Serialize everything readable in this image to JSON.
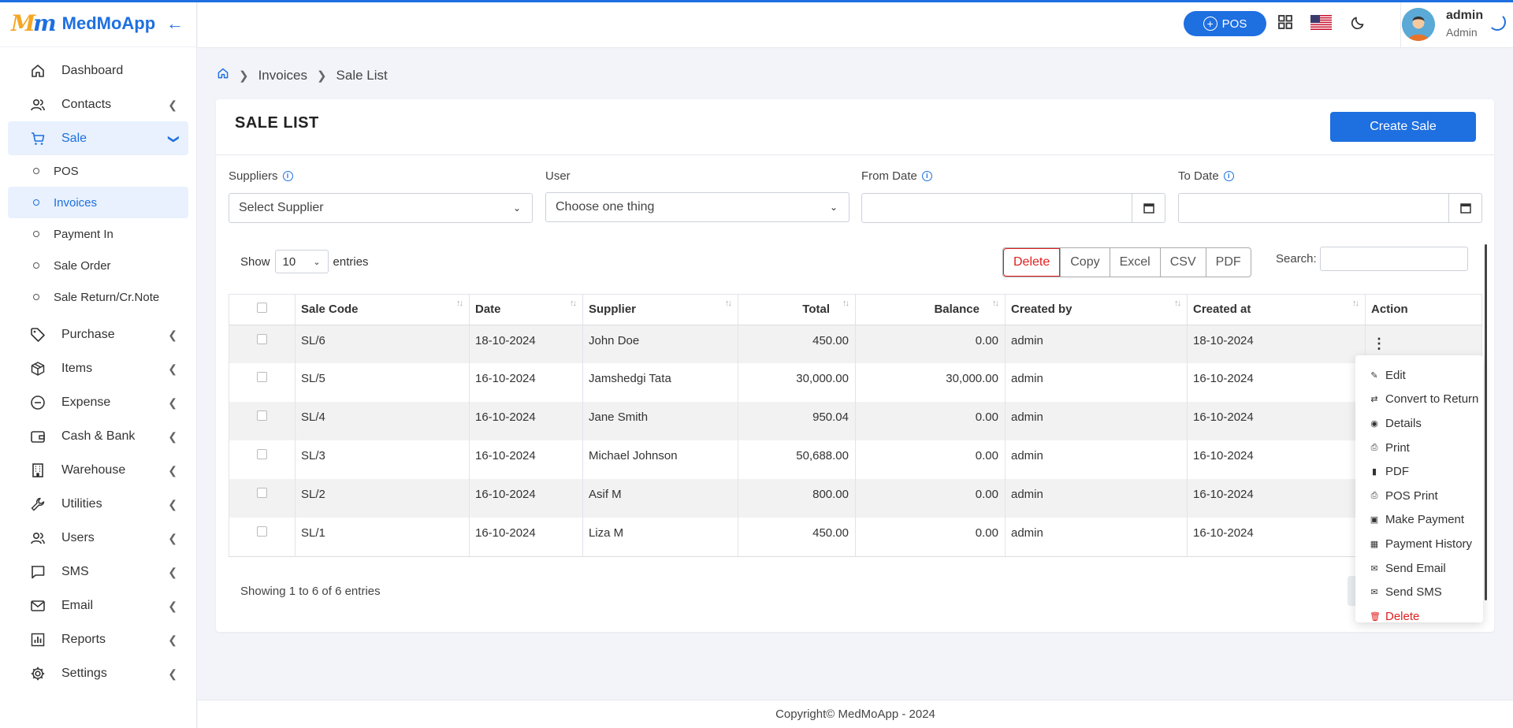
{
  "brand": {
    "logo": "Mm",
    "name": "MedMoApp"
  },
  "sidebar": {
    "items": [
      {
        "label": "Dashboard",
        "icon": "home-icon"
      },
      {
        "label": "Contacts",
        "icon": "users-icon"
      },
      {
        "label": "Sale",
        "icon": "cart-icon"
      },
      {
        "label": "Purchase",
        "icon": "tag-icon"
      },
      {
        "label": "Items",
        "icon": "box-icon"
      },
      {
        "label": "Expense",
        "icon": "minus-circle-icon"
      },
      {
        "label": "Cash & Bank",
        "icon": "wallet-icon"
      },
      {
        "label": "Warehouse",
        "icon": "building-icon"
      },
      {
        "label": "Utilities",
        "icon": "wrench-icon"
      },
      {
        "label": "Users",
        "icon": "users-icon"
      },
      {
        "label": "SMS",
        "icon": "message-icon"
      },
      {
        "label": "Email",
        "icon": "mail-icon"
      },
      {
        "label": "Reports",
        "icon": "chart-icon"
      },
      {
        "label": "Settings",
        "icon": "gear-icon"
      }
    ],
    "sale_sub": [
      "POS",
      "Invoices",
      "Payment In",
      "Sale Order",
      "Sale Return/Cr.Note"
    ]
  },
  "header": {
    "pos_label": "POS",
    "user_name": "admin",
    "user_role": "Admin"
  },
  "breadcrumb": {
    "items": [
      "Invoices",
      "Sale List"
    ]
  },
  "page": {
    "title": "SALE LIST",
    "create_label": "Create Sale"
  },
  "filters": {
    "suppliers": {
      "label": "Suppliers",
      "value": "Select Supplier"
    },
    "user": {
      "label": "User",
      "value": "Choose one thing"
    },
    "from_date": {
      "label": "From Date",
      "value": ""
    },
    "to_date": {
      "label": "To Date",
      "value": ""
    }
  },
  "table_controls": {
    "show": "Show",
    "entries_value": "10",
    "entries": "entries",
    "buttons": [
      "Delete",
      "Copy",
      "Excel",
      "CSV",
      "PDF"
    ],
    "search_label": "Search:"
  },
  "table": {
    "columns": [
      "Sale Code",
      "Date",
      "Supplier",
      "Total",
      "Balance",
      "Created by",
      "Created at",
      "Action"
    ],
    "rows": [
      [
        "SL/6",
        "18-10-2024",
        "John Doe",
        "450.00",
        "0.00",
        "admin",
        "18-10-2024"
      ],
      [
        "SL/5",
        "16-10-2024",
        "Jamshedgi Tata",
        "30,000.00",
        "30,000.00",
        "admin",
        "16-10-2024"
      ],
      [
        "SL/4",
        "16-10-2024",
        "Jane Smith",
        "950.04",
        "0.00",
        "admin",
        "16-10-2024"
      ],
      [
        "SL/3",
        "16-10-2024",
        "Michael Johnson",
        "50,688.00",
        "0.00",
        "admin",
        "16-10-2024"
      ],
      [
        "SL/2",
        "16-10-2024",
        "Asif M",
        "800.00",
        "0.00",
        "admin",
        "16-10-2024"
      ],
      [
        "SL/1",
        "16-10-2024",
        "Liza M",
        "450.00",
        "0.00",
        "admin",
        "16-10-2024"
      ]
    ]
  },
  "showing": "Showing 1 to 6 of 6 entries",
  "action_menu": [
    {
      "label": "Edit",
      "icon": "edit-icon"
    },
    {
      "label": "Convert to Return",
      "icon": "swap-icon"
    },
    {
      "label": "Details",
      "icon": "eye-icon"
    },
    {
      "label": "Print",
      "icon": "printer-icon"
    },
    {
      "label": "PDF",
      "icon": "file-icon"
    },
    {
      "label": "POS Print",
      "icon": "printer-icon"
    },
    {
      "label": "Make Payment",
      "icon": "cash-icon"
    },
    {
      "label": "Payment History",
      "icon": "table-icon"
    },
    {
      "label": "Send Email",
      "icon": "mail-icon"
    },
    {
      "label": "Send SMS",
      "icon": "mail-icon"
    },
    {
      "label": "Delete",
      "icon": "trash-icon"
    }
  ],
  "footer": "Copyright© MedMoApp - 2024",
  "colors": {
    "primary": "#1e6fe0",
    "danger": "#e02020",
    "active_bg": "#e8f1fd"
  }
}
